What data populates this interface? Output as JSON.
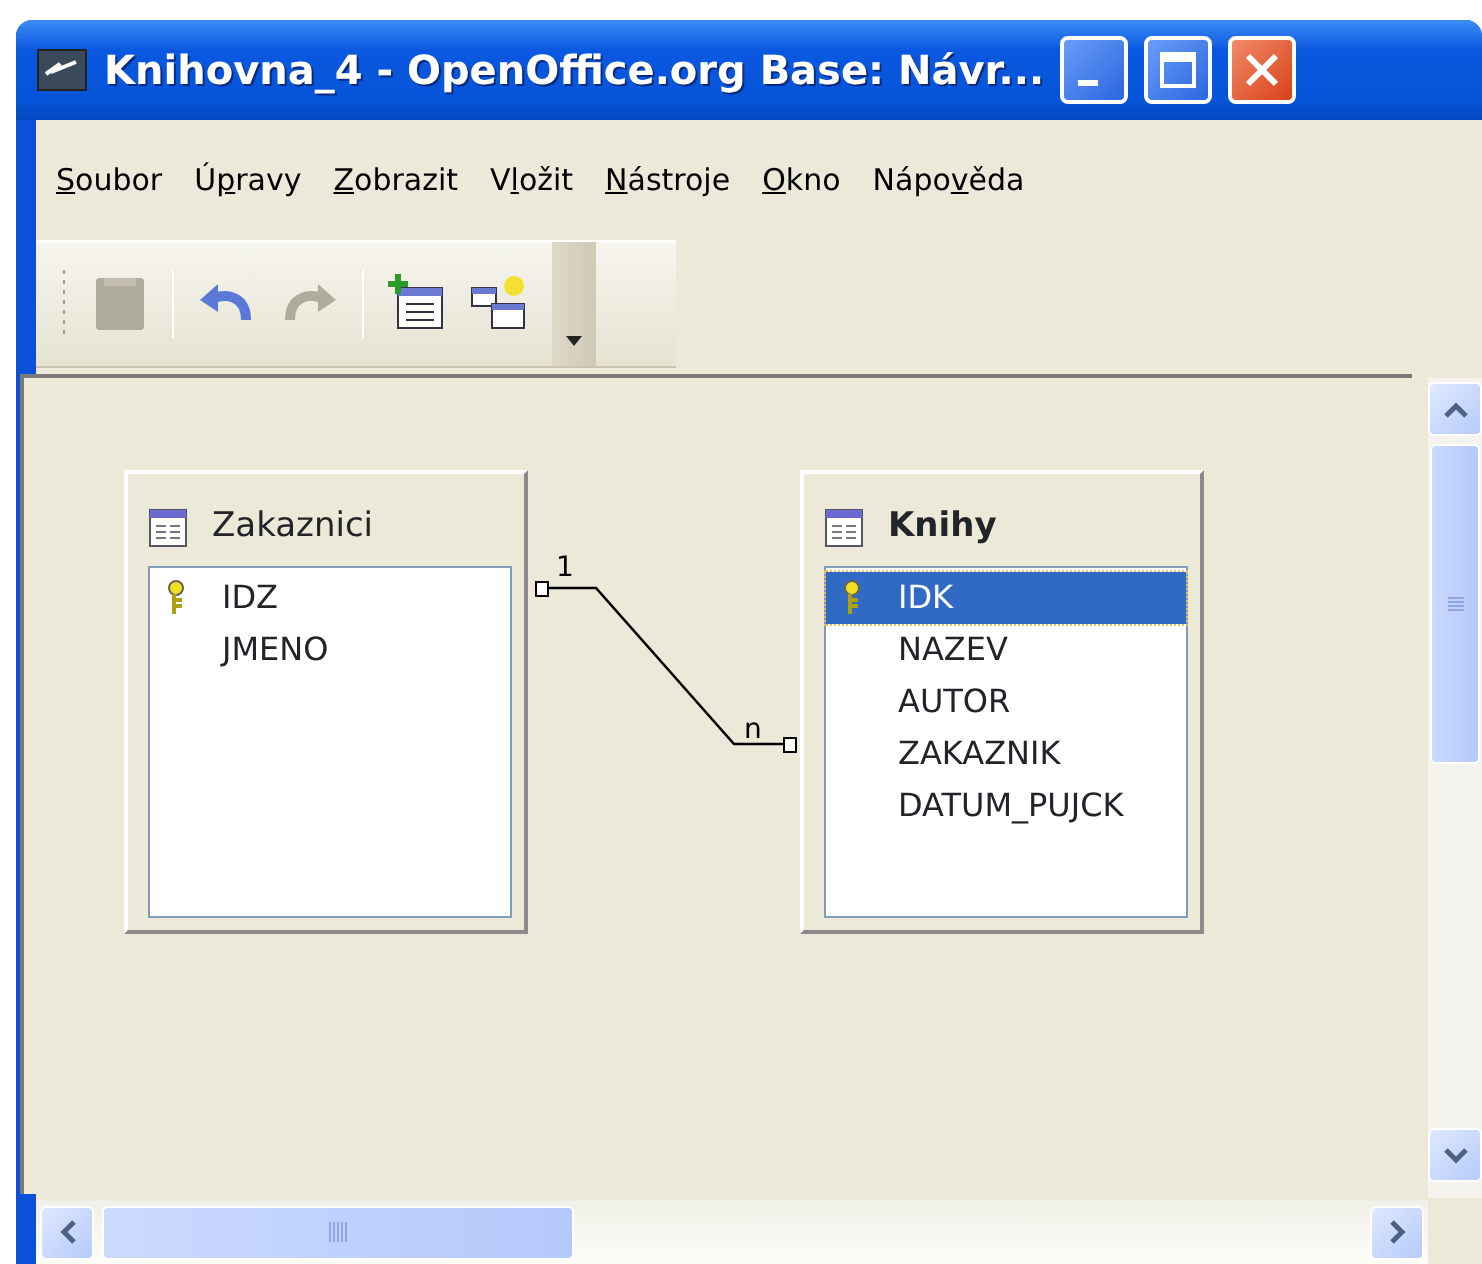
{
  "window": {
    "title": "Knihovna_4 - OpenOffice.org Base: Návr..."
  },
  "menu": [
    {
      "key": "S",
      "after": "oubor"
    },
    {
      "before": "Ú",
      "key": "p",
      "after": "ravy"
    },
    {
      "key": "Z",
      "after": "obrazit"
    },
    {
      "before": "V",
      "key": "l",
      "after": "ožit"
    },
    {
      "key": "N",
      "after": "ástroje"
    },
    {
      "key": "O",
      "after": "kno"
    },
    {
      "before": "Nápo",
      "key": "v",
      "after": "ěda"
    }
  ],
  "toolbar": [
    {
      "kind": "save",
      "disabled": true
    },
    {
      "kind": "sep"
    },
    {
      "kind": "undo",
      "disabled": false
    },
    {
      "kind": "redo",
      "disabled": true
    },
    {
      "kind": "sep"
    },
    {
      "kind": "newtable",
      "disabled": false
    },
    {
      "kind": "relation",
      "disabled": false
    },
    {
      "kind": "more"
    }
  ],
  "tables": [
    {
      "title": "Zakaznici",
      "active": false,
      "fields": [
        {
          "name": "IDZ",
          "key": true,
          "selected": false
        },
        {
          "name": "JMENO",
          "key": false,
          "selected": false
        }
      ]
    },
    {
      "title": "Knihy",
      "active": true,
      "fields": [
        {
          "name": "IDK",
          "key": true,
          "selected": true
        },
        {
          "name": "NAZEV",
          "key": false,
          "selected": false
        },
        {
          "name": "AUTOR",
          "key": false,
          "selected": false
        },
        {
          "name": "ZAKAZNIK",
          "key": false,
          "selected": false
        },
        {
          "name": "DATUM_PUJCK",
          "key": false,
          "selected": false
        }
      ]
    }
  ],
  "relation": {
    "from_label": "1",
    "to_label": "n"
  }
}
